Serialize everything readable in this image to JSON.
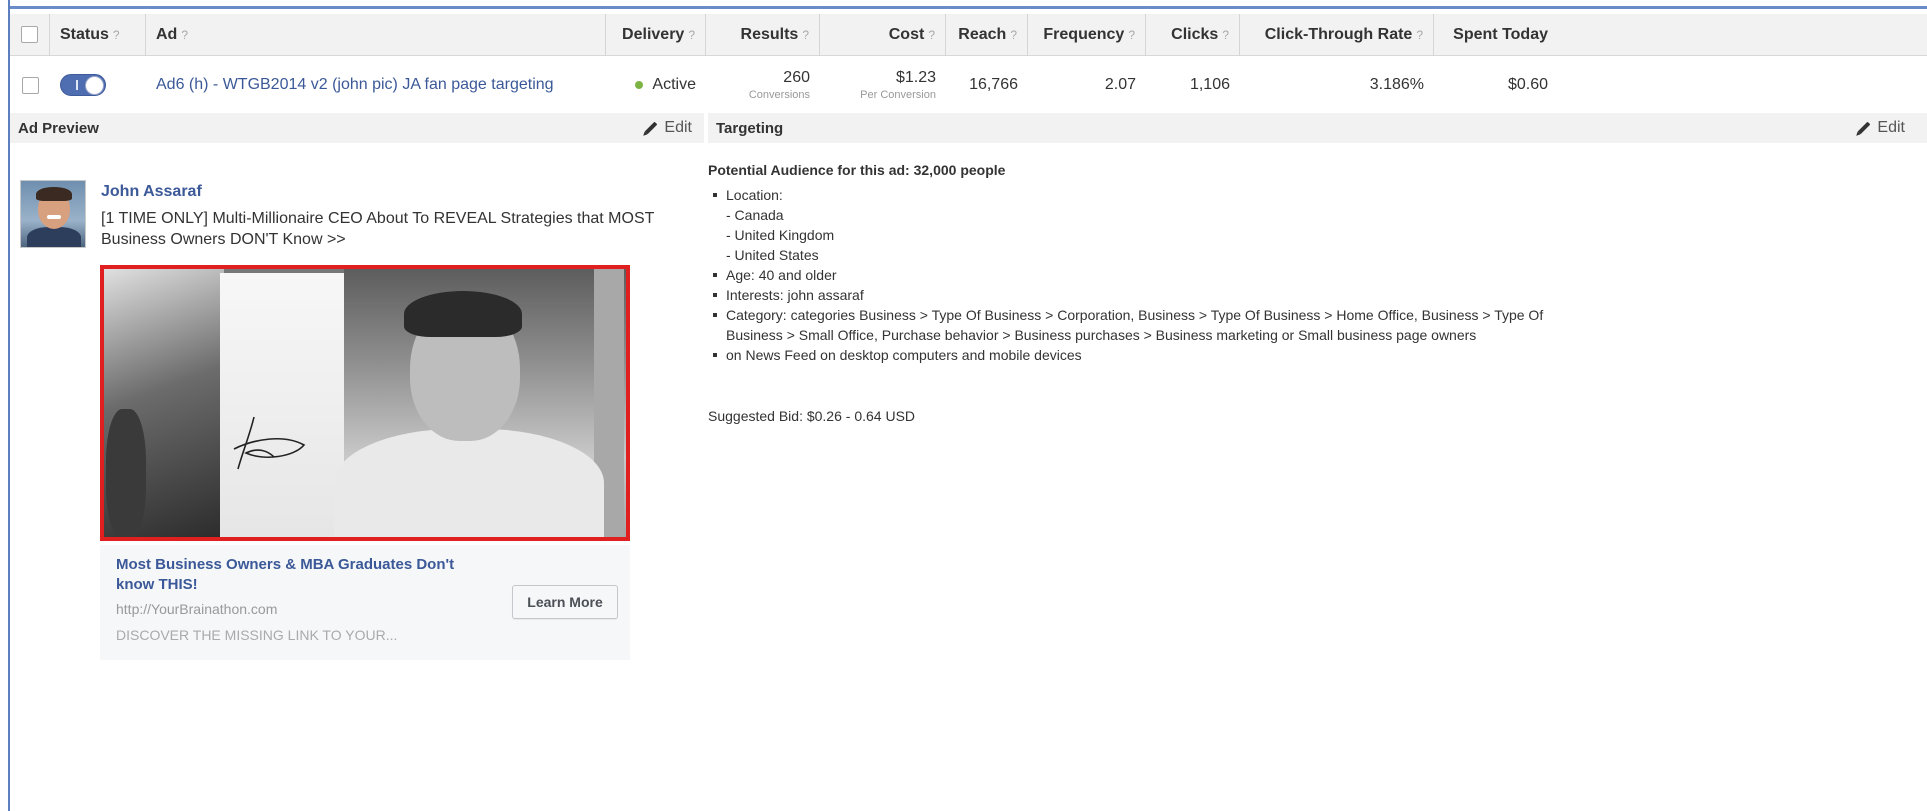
{
  "table": {
    "headers": {
      "status": "Status",
      "ad": "Ad",
      "delivery": "Delivery",
      "results": "Results",
      "cost": "Cost",
      "reach": "Reach",
      "frequency": "Frequency",
      "clicks": "Clicks",
      "ctr": "Click-Through Rate",
      "spent_today": "Spent Today",
      "help_mark": "?"
    },
    "row": {
      "ad_name": "Ad6 (h) - WTGB2014 v2 (john pic) JA fan page targeting",
      "delivery": "Active",
      "results_value": "260",
      "results_label": "Conversions",
      "cost_value": "$1.23",
      "cost_label": "Per Conversion",
      "reach": "16,766",
      "frequency": "2.07",
      "clicks": "1,106",
      "ctr": "3.186%",
      "spent_today": "$0.60",
      "status_toggle_on": true
    }
  },
  "ad_preview": {
    "section_title": "Ad Preview",
    "edit_label": "Edit",
    "author": "John Assaraf",
    "text": "[1 TIME ONLY] Multi-Millionaire CEO About To REVEAL Strategies that MOST Business Owners DON'T Know >>",
    "link_title": "Most Business Owners & MBA Graduates Don't know THIS!",
    "link_url": "http://YourBrainathon.com",
    "link_description": "DISCOVER THE MISSING LINK TO YOUR...",
    "cta_label": "Learn More",
    "image_border_color": "#e02020"
  },
  "targeting": {
    "section_title": "Targeting",
    "edit_label": "Edit",
    "audience": "Potential Audience for this ad: 32,000 people",
    "location_label": "Location:",
    "locations": [
      "- Canada",
      "- United Kingdom",
      "- United States"
    ],
    "age": "Age: 40 and older",
    "interests": "Interests: john assaraf",
    "category": "Category: categories Business > Type Of Business > Corporation, Business > Type Of Business > Home Office, Business > Type Of Business > Small Office, Purchase behavior > Business purchases > Business marketing or Small business page owners",
    "placement": "on News Feed on desktop computers and mobile devices",
    "suggested_bid": "Suggested Bid: $0.26 - 0.64 USD"
  },
  "colors": {
    "link": "#3b5998",
    "active_dot": "#7cb342",
    "toggle_on": "#4f6db1",
    "header_bg": "#f2f2f2"
  }
}
